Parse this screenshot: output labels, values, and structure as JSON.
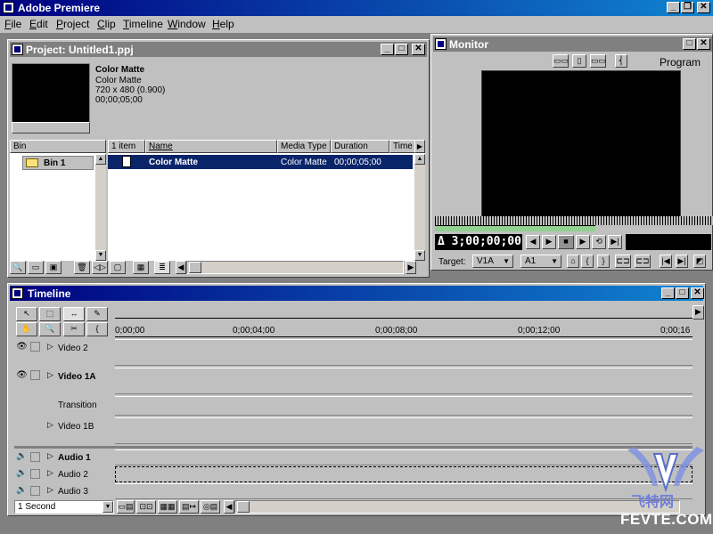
{
  "app": {
    "title": "Adobe Premiere",
    "menu": [
      "File",
      "Edit",
      "Project",
      "Clip",
      "Timeline",
      "Window",
      "Help"
    ],
    "menu_underline": [
      "F",
      "E",
      "P",
      "C",
      "T",
      "W",
      "H"
    ]
  },
  "project": {
    "title": "Project: Untitled1.ppj",
    "preview": {
      "name_bold": "Color Matte",
      "type": "Color Matte",
      "size": "720 x 480 (0.900)",
      "duration": "00;00;05;00"
    },
    "bin_header": "Bin",
    "bins": [
      "Bin 1"
    ],
    "columns": [
      "1 item",
      "Name",
      "Media Type",
      "Duration",
      "Time"
    ],
    "items": [
      {
        "name": "Color Matte",
        "media_type": "Color Matte",
        "duration": "00;00;05;00"
      }
    ]
  },
  "monitor": {
    "title": "Monitor",
    "program_label": "Program",
    "timecode": "Δ 3;00;00;00",
    "target_label": "Target:",
    "video_target": "V1A",
    "audio_target": "A1"
  },
  "timeline": {
    "title": "Timeline",
    "ruler": [
      "0;00;00",
      "0;00;04;00",
      "0;00;08;00",
      "0;00;12;00",
      "0;00;16"
    ],
    "tracks": [
      {
        "label": "Video 2",
        "bold": false
      },
      {
        "label": "Video 1A",
        "bold": true
      },
      {
        "label": "Transition",
        "bold": false
      },
      {
        "label": "Video 1B",
        "bold": false
      },
      {
        "label": "Audio 1",
        "bold": true
      },
      {
        "label": "Audio 2",
        "bold": false
      },
      {
        "label": "Audio 3",
        "bold": false
      }
    ],
    "zoom": "1 Second"
  },
  "watermark": {
    "logo_text": "飞特网",
    "domain": "FEVTE.COM"
  },
  "colors": {
    "titlebar_active": "#000080",
    "face": "#c0c0c0",
    "selection": "#0a246a"
  }
}
